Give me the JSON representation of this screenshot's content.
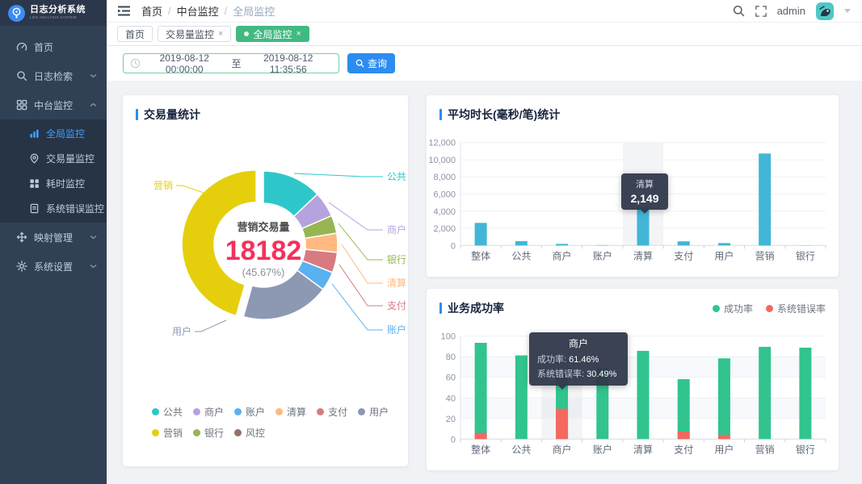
{
  "app": {
    "title": "日志分析系统",
    "subtitle": "LOG ANALYSIS SYSTEM"
  },
  "sidebar": {
    "items": [
      {
        "label": "首页"
      },
      {
        "label": "日志检索"
      },
      {
        "label": "中台监控"
      },
      {
        "label": "映射管理"
      },
      {
        "label": "系统设置"
      }
    ],
    "sub_items": [
      {
        "label": "全局监控",
        "active": true
      },
      {
        "label": "交易量监控"
      },
      {
        "label": "耗时监控"
      },
      {
        "label": "系统错误监控"
      }
    ]
  },
  "header": {
    "breadcrumb": [
      "首页",
      "中台监控",
      "全局监控"
    ],
    "user": "admin"
  },
  "tabs": [
    {
      "label": "首页"
    },
    {
      "label": "交易量监控",
      "close": "×"
    },
    {
      "label": "全局监控",
      "close": "×",
      "active": true
    }
  ],
  "filter": {
    "start": "2019-08-12 00:00:00",
    "separator": "至",
    "end": "2019-08-12 11:35:56",
    "search_label": "查询"
  },
  "chart_data": [
    {
      "type": "pie",
      "title": "交易量统计",
      "center_label": {
        "name": "营销交易量",
        "value": "18182",
        "percent": "(45.67%)"
      },
      "center_value_color": "#f5305c",
      "segments": [
        {
          "name": "公共",
          "percent": 12.94,
          "color": "#2ec7c9"
        },
        {
          "name": "商户",
          "percent": 5.56,
          "color": "#b6a2de"
        },
        {
          "name": "银行",
          "percent": 3.89,
          "color": "#97b552"
        },
        {
          "name": "清算",
          "percent": 4.17,
          "color": "#ffb980"
        },
        {
          "name": "支付",
          "percent": 4.44,
          "color": "#d87a80"
        },
        {
          "name": "账户",
          "percent": 4.17,
          "color": "#5ab1ef"
        },
        {
          "name": "用户",
          "percent": 19.16,
          "color": "#8d98b3"
        },
        {
          "name": "营销",
          "percent": 45.67,
          "color": "#e5cf0d",
          "selected": true,
          "value": 18182
        }
      ],
      "legend": [
        {
          "name": "公共",
          "color": "#2ec7c9"
        },
        {
          "name": "商户",
          "color": "#b6a2de"
        },
        {
          "name": "账户",
          "color": "#5ab1ef"
        },
        {
          "name": "清算",
          "color": "#ffb980"
        },
        {
          "name": "支付",
          "color": "#d87a80"
        },
        {
          "name": "用户",
          "color": "#8d98b3"
        },
        {
          "name": "营销",
          "color": "#e5cf0d"
        },
        {
          "name": "银行",
          "color": "#97b552"
        },
        {
          "name": "风控",
          "color": "#95706d"
        }
      ]
    },
    {
      "type": "bar",
      "title": "平均时长(毫秒/笔)统计",
      "categories": [
        "整体",
        "公共",
        "商户",
        "账户",
        "清算",
        "支付",
        "用户",
        "营销",
        "银行"
      ],
      "values": [
        2633,
        500,
        180,
        40,
        4450,
        480,
        280,
        10720,
        15
      ],
      "ylim": [
        0,
        12000
      ],
      "ytick": 2000,
      "bar_color": "#41b6d7",
      "hover_index": 4,
      "tooltip": {
        "title": "清算",
        "value": "2,149"
      }
    },
    {
      "type": "bar",
      "title": "业务成功率",
      "categories": [
        "整体",
        "公共",
        "商户",
        "账户",
        "清算",
        "支付",
        "用户",
        "营销",
        "银行"
      ],
      "series": [
        {
          "name": "成功率",
          "color": "#31c48f",
          "values": [
            93.5,
            81.3,
            59.5,
            69.2,
            85.7,
            58.2,
            78.4,
            89.6,
            88.8
          ]
        },
        {
          "name": "系统错误率",
          "color": "#f5685f",
          "values": [
            6,
            0,
            29.5,
            0,
            0,
            7.3,
            4.2,
            0,
            0
          ]
        }
      ],
      "ylim": [
        0,
        100
      ],
      "ytick": 20,
      "hover_index": 2,
      "tooltip": {
        "title": "商户",
        "rows": [
          {
            "label": "成功率:",
            "value": "61.46%"
          },
          {
            "label": "系统错误率:",
            "value": "30.49%"
          }
        ]
      }
    }
  ]
}
